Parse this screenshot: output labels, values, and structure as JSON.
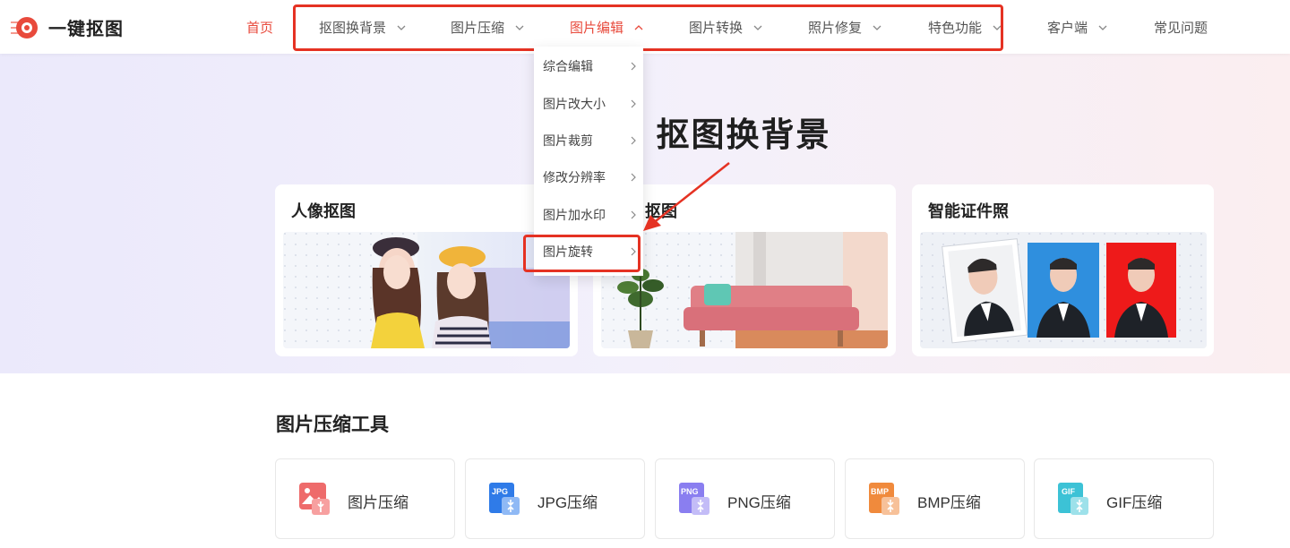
{
  "brand": {
    "name": "一键抠图",
    "accent": "#e84a3c",
    "highlight": "#e53223"
  },
  "nav": {
    "home": "首页",
    "items": [
      {
        "label": "抠图换背景",
        "active": false
      },
      {
        "label": "图片压缩",
        "active": false
      },
      {
        "label": "图片编辑",
        "active": true
      },
      {
        "label": "图片转换",
        "active": false
      },
      {
        "label": "照片修复",
        "active": false
      },
      {
        "label": "特色功能",
        "active": false
      },
      {
        "label": "客户端",
        "active": false
      }
    ],
    "faq": "常见问题"
  },
  "dropdown": {
    "items": [
      "综合编辑",
      "图片改大小",
      "图片裁剪",
      "修改分辨率",
      "图片加水印",
      "图片旋转"
    ],
    "highlighted": "图片旋转"
  },
  "hero": {
    "title": "抠图换背景",
    "cards": [
      {
        "title": "人像抠图",
        "icon": "portrait-photo"
      },
      {
        "title": "抠图",
        "icon": "furniture-photo"
      },
      {
        "title": "智能证件照",
        "icon": "id-photo"
      }
    ]
  },
  "tools": {
    "title": "图片压缩工具",
    "items": [
      {
        "label": "图片压缩",
        "icon": "image-compress-icon",
        "badge": "",
        "color": "#ee6b6b"
      },
      {
        "label": "JPG压缩",
        "icon": "jpg-icon",
        "badge": "JPG",
        "color": "#2f7be8"
      },
      {
        "label": "PNG压缩",
        "icon": "png-icon",
        "badge": "PNG",
        "color": "#8a7ef0"
      },
      {
        "label": "BMP压缩",
        "icon": "bmp-icon",
        "badge": "BMP",
        "color": "#f08a3c"
      },
      {
        "label": "GIF压缩",
        "icon": "gif-icon",
        "badge": "GIF",
        "color": "#3cc2d6"
      }
    ]
  }
}
